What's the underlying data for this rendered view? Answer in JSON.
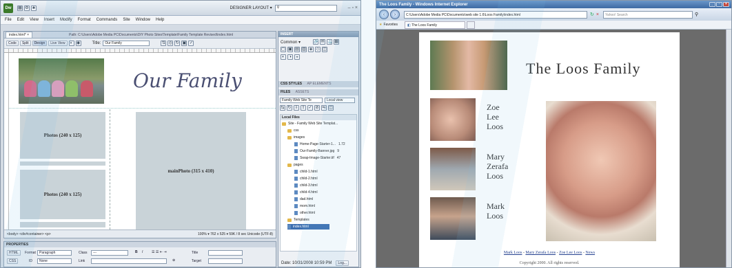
{
  "dreamweaver": {
    "layout_label": "DESIGNER LAYOUT ▾",
    "menu": [
      "File",
      "Edit",
      "View",
      "Insert",
      "Modify",
      "Format",
      "Commands",
      "Site",
      "Window",
      "Help"
    ],
    "doc_tab": "index.html*",
    "doc_path": "Path: C:\\Users\\Adobe Media PC\\Documents\\DIY Photo Sites\\Template\\Family Template Revised\\index.html",
    "view_buttons": [
      "Code",
      "Split",
      "Design",
      "Live View"
    ],
    "title_label": "Title:",
    "title_value": "Our Family",
    "our_family_text": "Our Family",
    "placeholders": {
      "photo1": "Photos (240 x 125)",
      "photo2": "Photos (240 x 125)",
      "main": "mainPhoto (315 x 410)"
    },
    "status_left": "<body> <div#container> <p>",
    "status_right": "100%  ▾  762 x 525 ▾  59K / 8 sec  Unicode (UTF-8)",
    "properties": {
      "header": "PROPERTIES",
      "html": "HTML",
      "css": "CSS",
      "format_label": "Format",
      "format_value": "Paragraph",
      "id_label": "ID",
      "id_value": "None",
      "class_label": "Class",
      "class_value": "---",
      "link_label": "Link",
      "title_label": "Title",
      "target_label": "Target"
    },
    "insert_panel": {
      "header": "INSERT",
      "category": "Common ▾"
    },
    "css_panel": {
      "tab1": "CSS STYLES",
      "tab2": "AP ELEMENTS"
    },
    "files_panel": {
      "tab1": "FILES",
      "tab2": "ASSETS",
      "site_select": "Family Web Site Te",
      "view_select": "Local view",
      "local_files": "Local Files",
      "tree": [
        {
          "label": "Site - Family Web Site Templat...",
          "kind": "folder",
          "indent": 0
        },
        {
          "label": "css",
          "kind": "folder",
          "indent": 1
        },
        {
          "label": "images",
          "kind": "folder",
          "indent": 1
        },
        {
          "label": "Home-Page-Starter-1...",
          "size": "1.72",
          "kind": "file",
          "indent": 2
        },
        {
          "label": "Our-Family-Banner.jpg",
          "size": "9",
          "kind": "file",
          "indent": 2
        },
        {
          "label": "Swap-Image-Starter.tif",
          "size": "47",
          "kind": "file",
          "indent": 2
        },
        {
          "label": "pages",
          "kind": "folder",
          "indent": 1
        },
        {
          "label": "child-1.html",
          "kind": "file",
          "indent": 2
        },
        {
          "label": "child-2.html",
          "kind": "file",
          "indent": 2
        },
        {
          "label": "child-3.html",
          "kind": "file",
          "indent": 2
        },
        {
          "label": "child-4.html",
          "kind": "file",
          "indent": 2
        },
        {
          "label": "dad.html",
          "kind": "file",
          "indent": 2
        },
        {
          "label": "mom.html",
          "kind": "file",
          "indent": 2
        },
        {
          "label": "other.html",
          "kind": "file",
          "indent": 2
        },
        {
          "label": "Templates",
          "kind": "folder",
          "indent": 1
        },
        {
          "label": "index.html",
          "kind": "file",
          "indent": 1,
          "selected": true
        }
      ],
      "date_status": "Date: 10/31/2008 10:59 PM",
      "log_button": "Log..."
    }
  },
  "ie": {
    "title": "The Loos Family - Windows Internet Explorer",
    "address": "C:\\Users\\Adobe Media PC\\Documents\\web site 1.6\\Loos Family\\index.html",
    "search_placeholder": "Yahoo! Search",
    "favorites": "Favorites",
    "tab": "The Loos Family",
    "family_title": "The Loos Family",
    "names": [
      [
        "Zoe",
        "Lee",
        "Loos"
      ],
      [
        "Mary",
        "Zerafa",
        "Loos"
      ],
      [
        "Mark",
        "Loos"
      ]
    ],
    "footer_links": [
      "Mark Loos",
      "Mary Zerafa Loos",
      "Zoe Lee Loos",
      "News"
    ],
    "copyright": "Copyright 2000. All rights reserved."
  },
  "colors": {
    "accent": "#3d6aa3",
    "placeholder_fill": "#c9d3d8",
    "dw_logo": "#3b7a2a"
  }
}
